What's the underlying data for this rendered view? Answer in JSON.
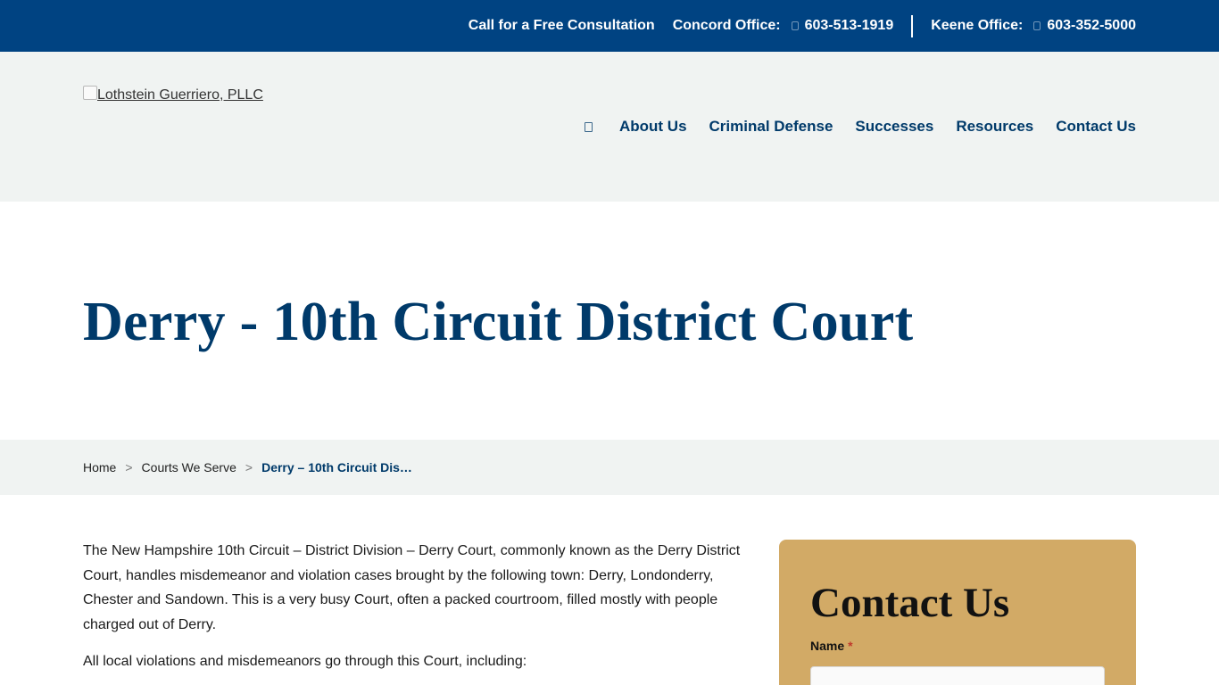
{
  "topbar": {
    "cta": "Call for a Free Consultation",
    "offices": [
      {
        "label": "Concord Office:",
        "phone": "603-513-1919"
      },
      {
        "label": "Keene Office:",
        "phone": "603-352-5000"
      }
    ],
    "background": "#004382"
  },
  "header": {
    "logo_alt": "Lothstein Guerriero, PLLC",
    "nav": [
      "About Us",
      "Criminal Defense",
      "Successes",
      "Resources",
      "Contact Us"
    ]
  },
  "hero": {
    "title": "Derry - 10th Circuit District Court"
  },
  "breadcrumb": {
    "items": [
      "Home",
      "Courts We Serve"
    ],
    "current": "Derry – 10th Circuit Dis…"
  },
  "content": {
    "paragraphs": [
      "The New Hampshire 10th Circuit – District Division – Derry Court, commonly known as the Derry District Court, handles misdemeanor and violation cases brought by the following town: Derry, Londonderry, Chester and Sandown. This is a very busy Court, often a packed courtroom, filled mostly with people charged out of Derry.",
      "All local violations and misdemeanors go through this Court, including:"
    ]
  },
  "contact_card": {
    "title": "Contact Us",
    "name_label": "Name",
    "required_mark": "*",
    "background": "#d2aa66"
  }
}
